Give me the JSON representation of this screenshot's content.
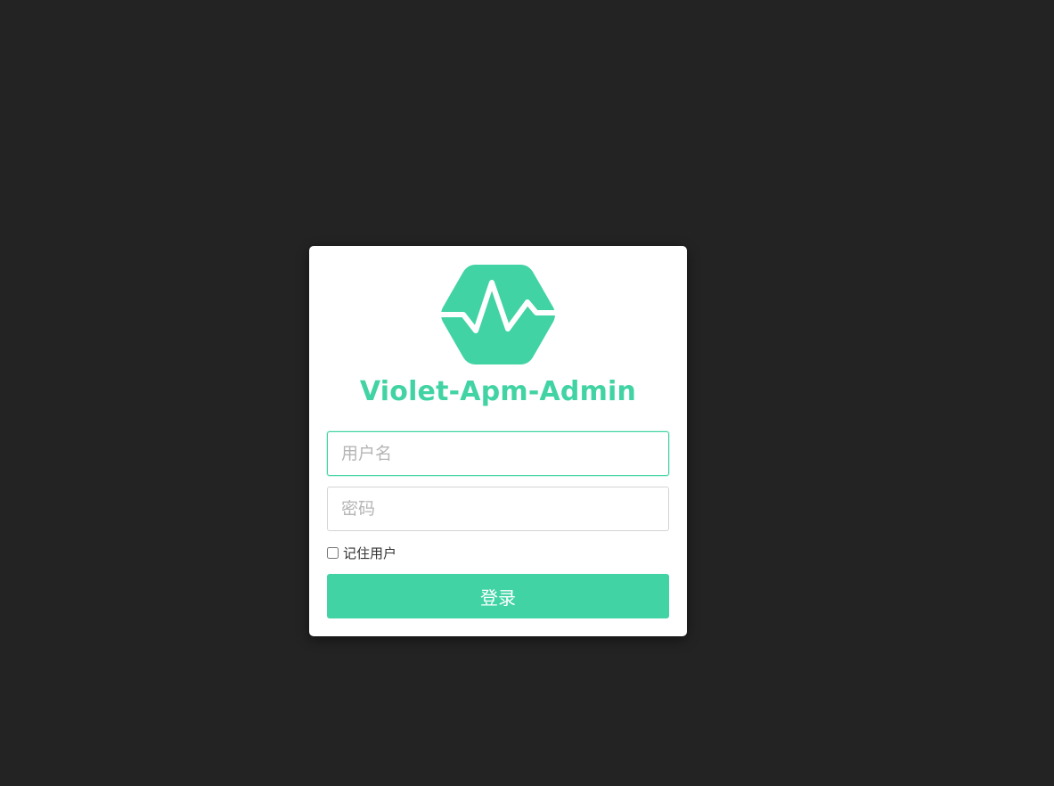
{
  "app": {
    "title": "Violet-Apm-Admin",
    "logo_icon": "pulse-hexagon-icon",
    "accent_color": "#41d3a4",
    "background_color": "#232323"
  },
  "login_form": {
    "username_placeholder": "用户名",
    "username_value": "",
    "password_placeholder": "密码",
    "password_value": "",
    "remember_label": "记住用户",
    "remember_checked": false,
    "submit_label": "登录"
  }
}
